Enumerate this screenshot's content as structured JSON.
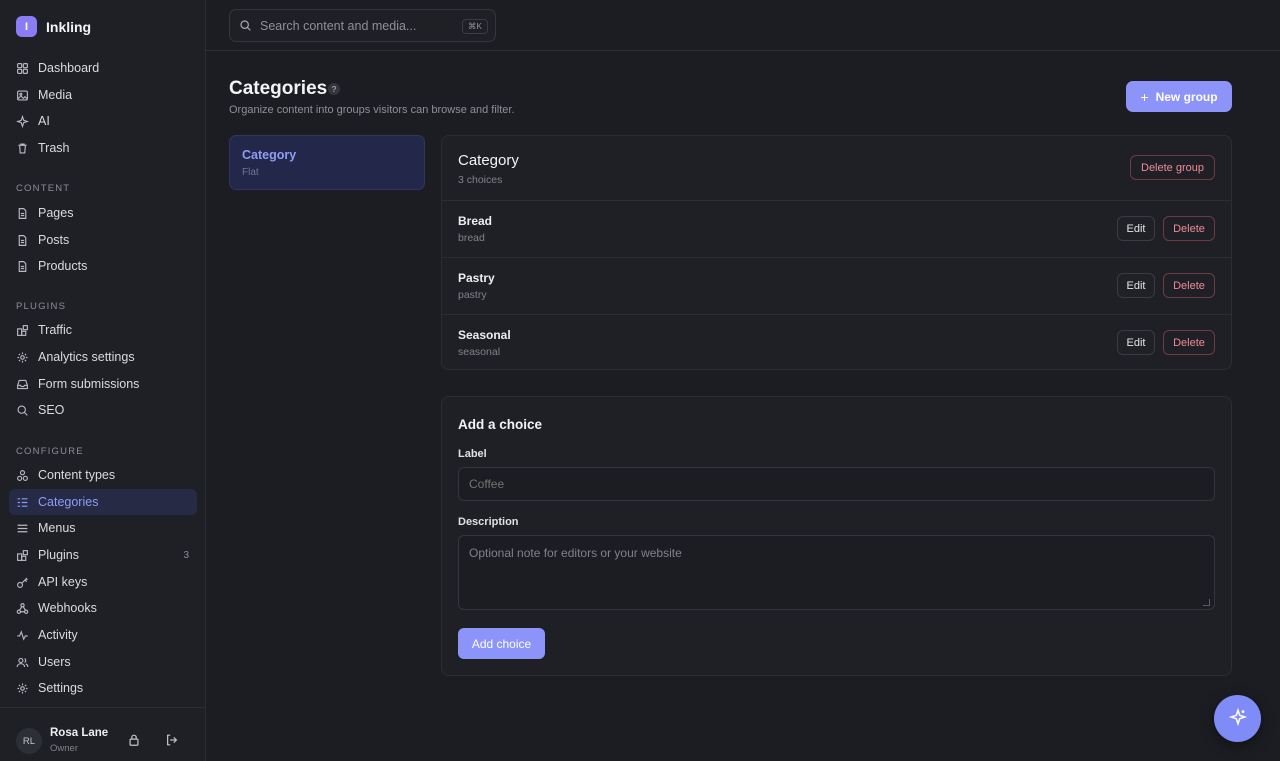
{
  "app": {
    "logo_letter": "I",
    "name": "Inkling"
  },
  "sidebar": {
    "top_items": [
      {
        "label": "Dashboard",
        "icon": "grid-icon"
      },
      {
        "label": "Media",
        "icon": "image-icon"
      },
      {
        "label": "AI",
        "icon": "sparkle-icon"
      },
      {
        "label": "Trash",
        "icon": "trash-icon"
      }
    ],
    "content_label": "CONTENT",
    "content_items": [
      {
        "label": "Pages",
        "icon": "document-icon"
      },
      {
        "label": "Posts",
        "icon": "document-icon"
      },
      {
        "label": "Products",
        "icon": "document-icon"
      }
    ],
    "plugins_label": "PLUGINS",
    "plugin_items": [
      {
        "label": "Traffic",
        "icon": "puzzle-icon"
      },
      {
        "label": "Analytics settings",
        "icon": "gear-icon"
      },
      {
        "label": "Form submissions",
        "icon": "inbox-icon"
      },
      {
        "label": "SEO",
        "icon": "search-icon"
      }
    ],
    "configure_label": "CONFIGURE",
    "configure_items": [
      {
        "label": "Content types",
        "icon": "shapes-icon"
      },
      {
        "label": "Categories",
        "icon": "list-icon",
        "active": true
      },
      {
        "label": "Menus",
        "icon": "menu-icon"
      },
      {
        "label": "Plugins",
        "icon": "puzzle-icon",
        "count": "3"
      },
      {
        "label": "API keys",
        "icon": "key-icon"
      },
      {
        "label": "Webhooks",
        "icon": "webhook-icon"
      },
      {
        "label": "Activity",
        "icon": "pulse-icon"
      },
      {
        "label": "Users",
        "icon": "users-icon"
      },
      {
        "label": "Settings",
        "icon": "gear-icon"
      }
    ],
    "user": {
      "initials": "RL",
      "name": "Rosa Lane",
      "role": "Owner"
    }
  },
  "search": {
    "placeholder": "Search content and media...",
    "shortcut": "⌘K"
  },
  "page": {
    "title": "Categories",
    "help": "?",
    "subtitle": "Organize content into groups visitors can browse and filter.",
    "new_group_label": "New group"
  },
  "groups": [
    {
      "name": "Category",
      "type": "Flat"
    }
  ],
  "detail": {
    "title": "Category",
    "count_text": "3 choices",
    "delete_group_label": "Delete group",
    "edit_label": "Edit",
    "delete_label": "Delete",
    "choices": [
      {
        "label": "Bread",
        "slug": "bread"
      },
      {
        "label": "Pastry",
        "slug": "pastry"
      },
      {
        "label": "Seasonal",
        "slug": "seasonal"
      }
    ]
  },
  "form": {
    "title": "Add a choice",
    "label_field": "Label",
    "label_placeholder": "Coffee",
    "description_field": "Description",
    "description_placeholder": "Optional note for editors or your website",
    "submit_label": "Add choice"
  },
  "colors": {
    "accent": "#8c93f9",
    "danger": "#f08a96",
    "background": "#1c1d22"
  }
}
